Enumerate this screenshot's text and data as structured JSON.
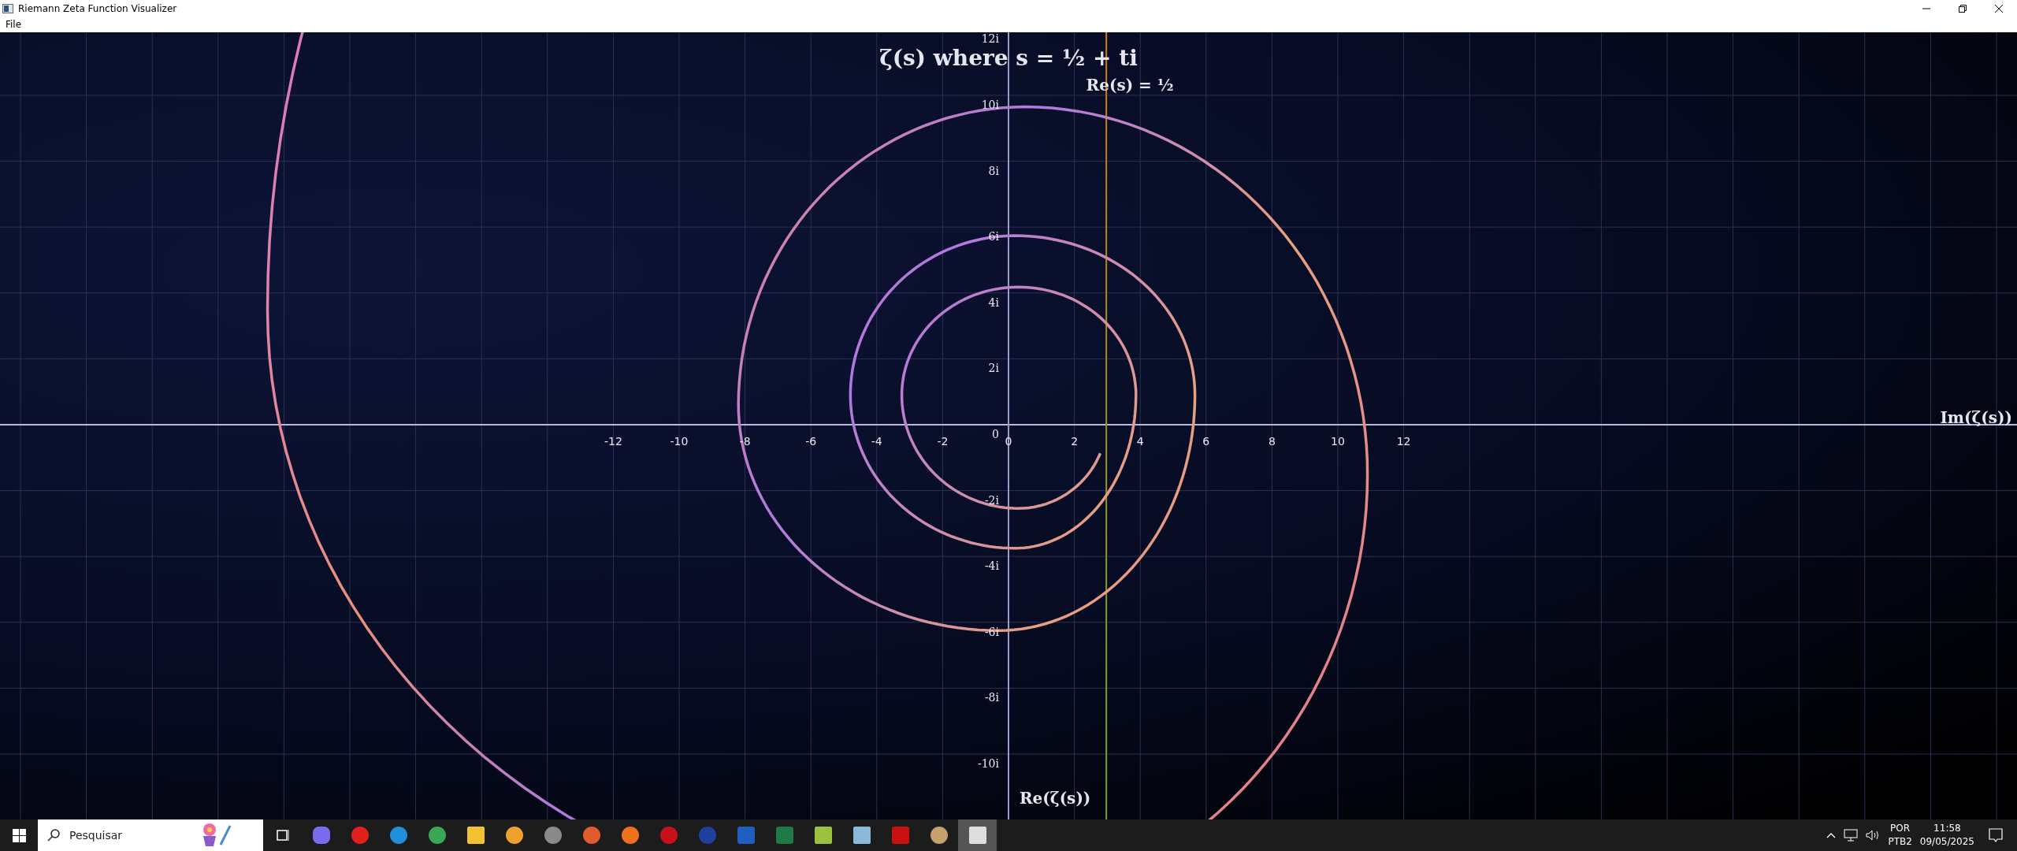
{
  "window": {
    "title": "Riemann Zeta Function Visualizer"
  },
  "menu": [
    "File"
  ],
  "plot": {
    "title": "ζ(s) where s = ½ + ti",
    "line_label": "Re(s) = ½",
    "horizontal_axis_label": "Im(ζ(s))",
    "vertical_axis_label": "Re(ζ(s))",
    "x_ticks": [
      "-12",
      "-10",
      "-8",
      "-6",
      "-4",
      "-2",
      "0",
      "2",
      "4",
      "6",
      "8",
      "10",
      "12"
    ],
    "y_ticks": [
      "12i",
      "10i",
      "8i",
      "6i",
      "4i",
      "2i",
      "0",
      "-2i",
      "-4i",
      "-6i",
      "-8i",
      "-10i"
    ]
  },
  "taskbar": {
    "search": {
      "placeholder": "Pesquisar"
    },
    "tray": {
      "language": "POR",
      "layout": "PTB2",
      "time": "11:58",
      "date": "09/05/2025"
    }
  }
}
